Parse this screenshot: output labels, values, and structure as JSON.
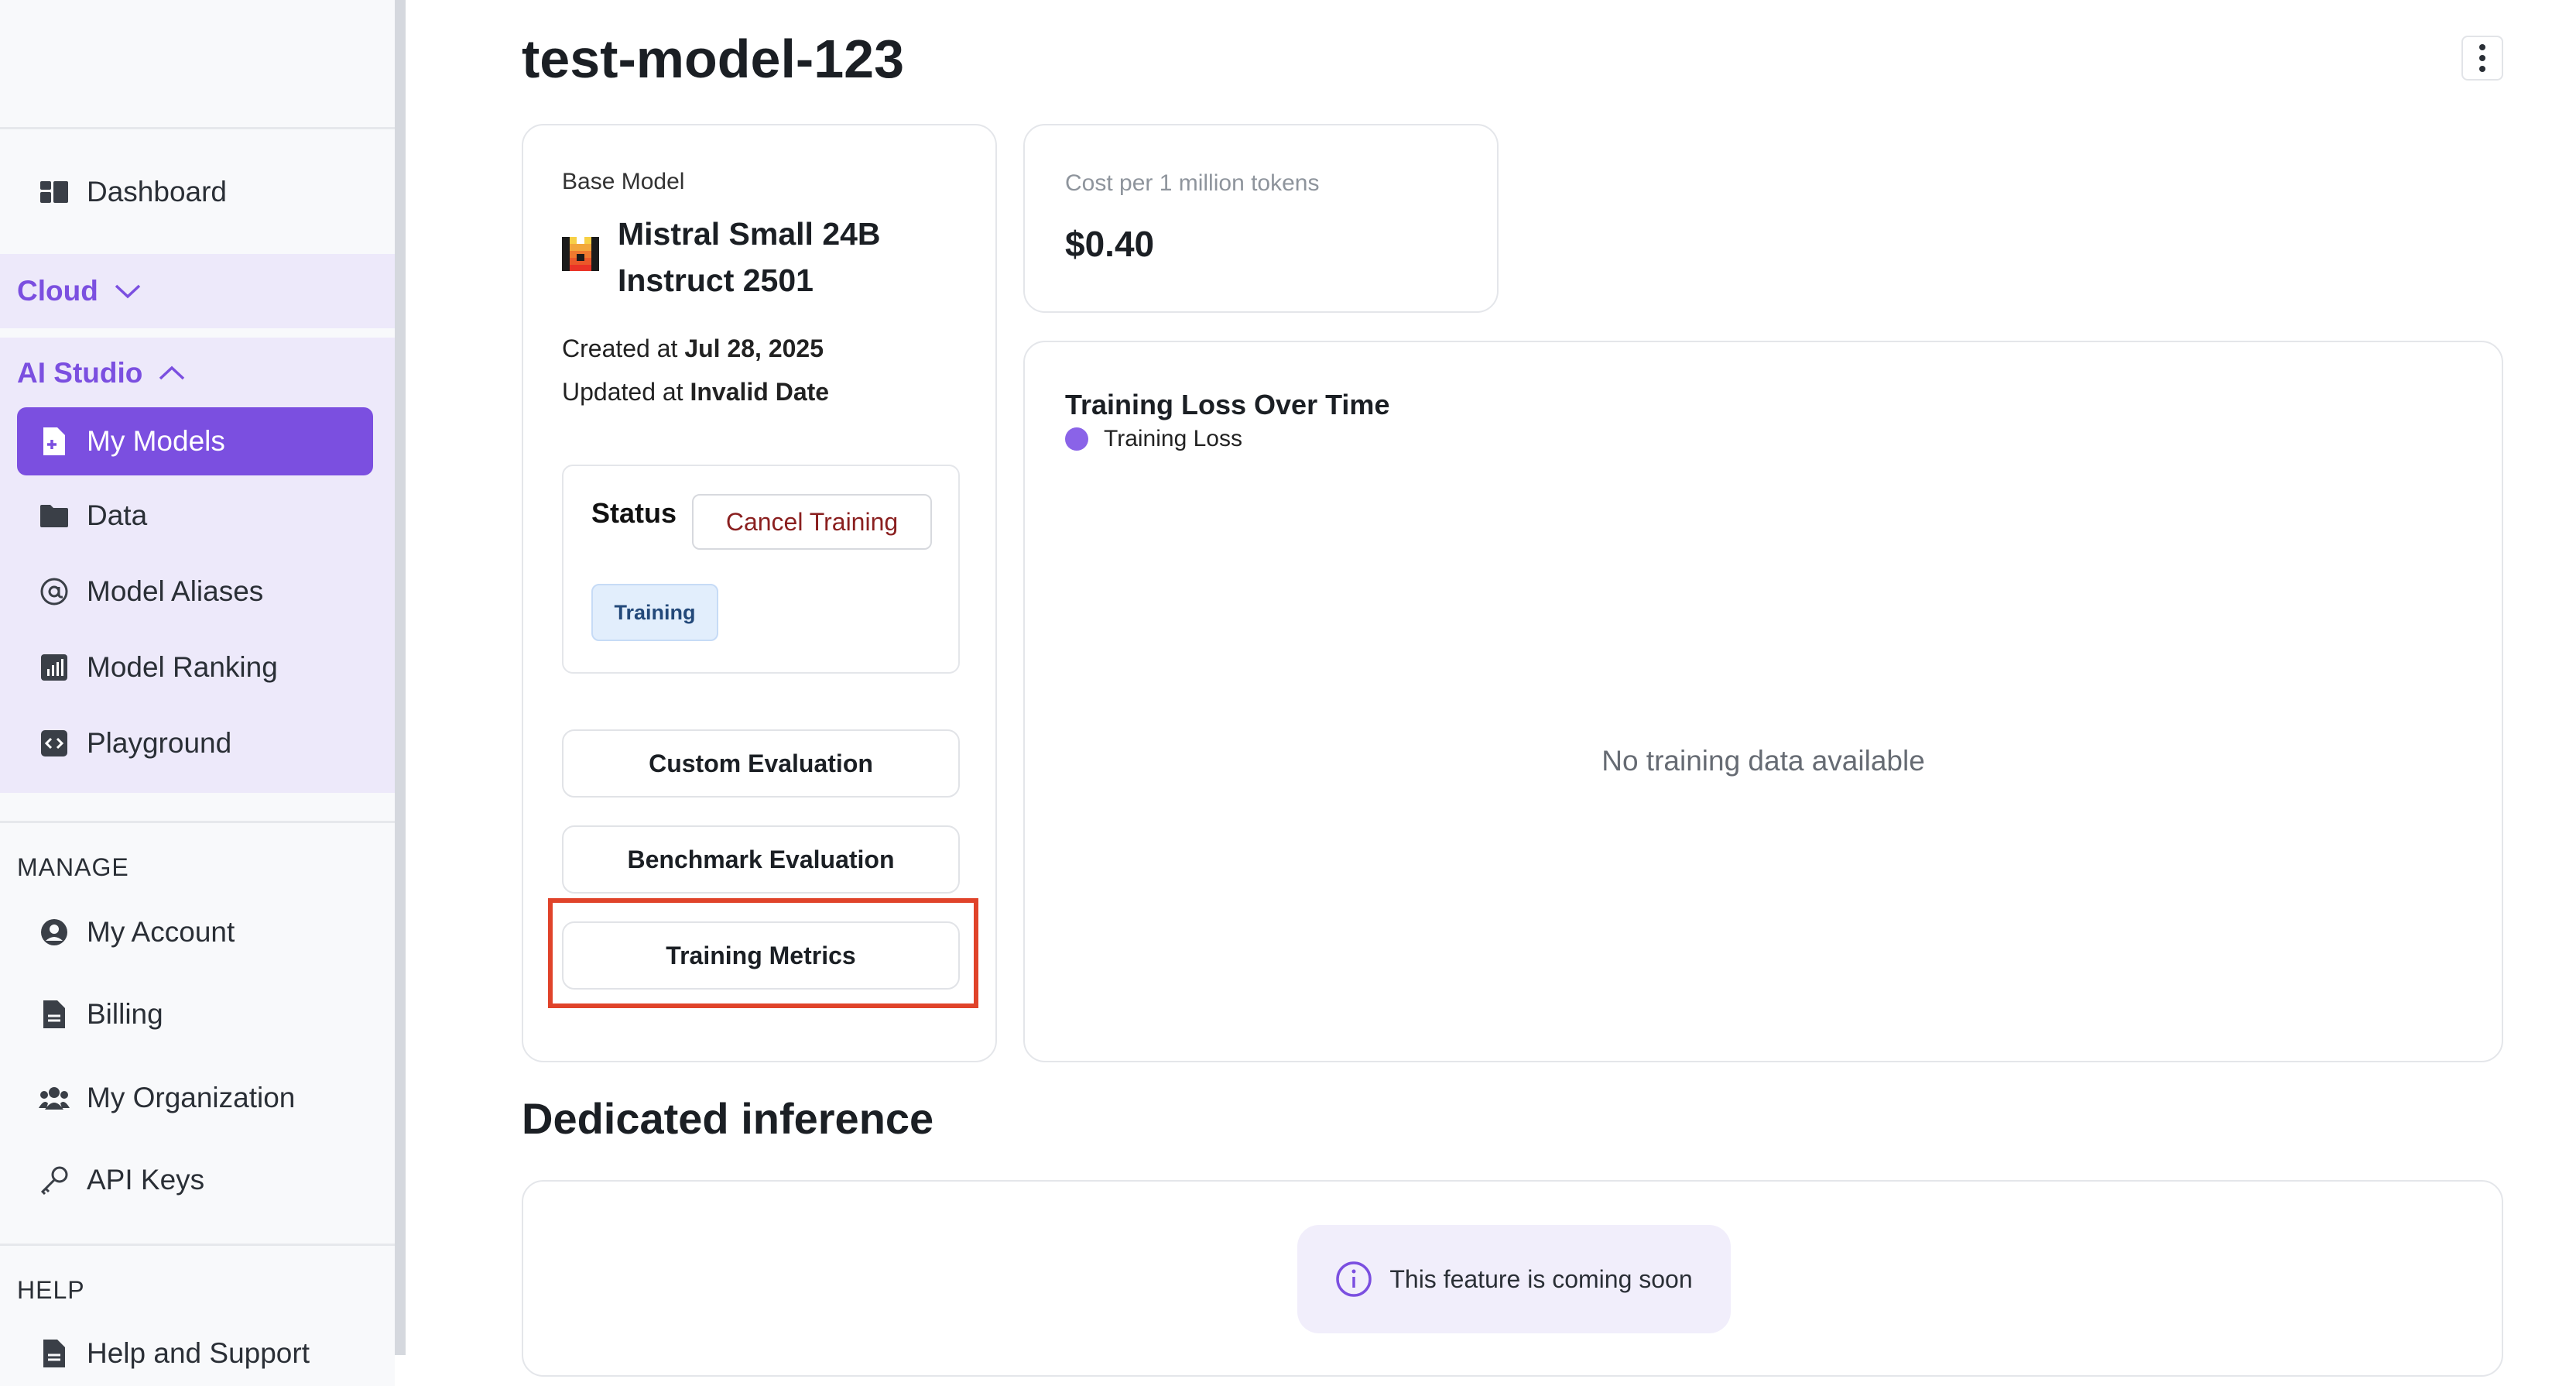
{
  "sidebar": {
    "dashboard": "Dashboard",
    "cloud": "Cloud",
    "ai_studio": "AI Studio",
    "ai_items": [
      "My Models",
      "Data",
      "Model Aliases",
      "Model Ranking",
      "Playground"
    ],
    "manage_label": "MANAGE",
    "manage_items": [
      "My Account",
      "Billing",
      "My Organization",
      "API Keys"
    ],
    "help_label": "HELP",
    "help_items": [
      "Help and Support"
    ]
  },
  "page": {
    "title": "test-model-123"
  },
  "model": {
    "base_label": "Base Model",
    "name_line1": "Mistral Small 24B",
    "name_line2": "Instruct 2501",
    "created_label": "Created at",
    "created_value": "Jul 28, 2025",
    "updated_label": "Updated at",
    "updated_value": "Invalid Date"
  },
  "status": {
    "label": "Status",
    "cancel_button": "Cancel Training",
    "badge": "Training"
  },
  "actions": {
    "custom_eval": "Custom Evaluation",
    "benchmark_eval": "Benchmark Evaluation",
    "training_metrics": "Training Metrics"
  },
  "cost": {
    "label": "Cost per 1 million tokens",
    "value": "$0.40"
  },
  "chart": {
    "title": "Training Loss Over Time",
    "legend": "Training Loss",
    "empty": "No training data available"
  },
  "dedicated": {
    "title": "Dedicated inference",
    "notice": "This feature is coming soon"
  },
  "colors": {
    "accent": "#7b4fe0",
    "highlight": "#e0432a",
    "badge_bg": "#e2eefc"
  }
}
